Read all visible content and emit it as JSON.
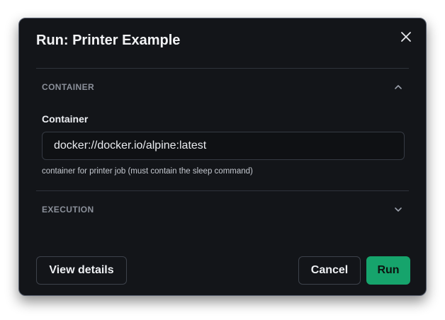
{
  "dialog": {
    "title": "Run: Printer Example",
    "close_icon": "close-icon"
  },
  "sections": {
    "container": {
      "label": "CONTAINER",
      "expanded": true,
      "chevron_icon": "chevron-up-icon",
      "field_label": "Container",
      "field_value": "docker://docker.io/alpine:latest",
      "help_text": "container for printer job (must contain the sleep command)"
    },
    "execution": {
      "label": "EXECUTION",
      "expanded": false,
      "chevron_icon": "chevron-down-icon"
    }
  },
  "footer": {
    "view_details_label": "View details",
    "cancel_label": "Cancel",
    "run_label": "Run"
  },
  "colors": {
    "dialog_bg": "#131519",
    "accent_run": "#16a46c",
    "muted_label": "#8b909a"
  }
}
